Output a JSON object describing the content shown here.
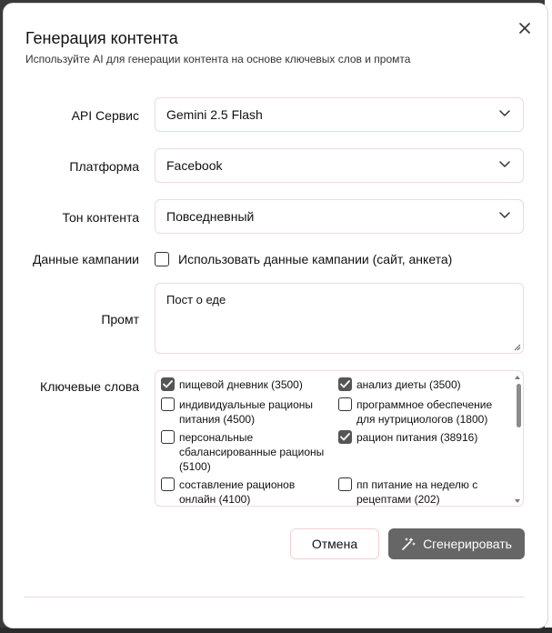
{
  "dialog": {
    "title": "Генерация контента",
    "subtitle": "Используйте AI для генерации контента на основе ключевых слов и промта"
  },
  "fields": {
    "api_label": "API Сервис",
    "api_value": "Gemini 2.5 Flash",
    "platform_label": "Платформа",
    "platform_value": "Facebook",
    "tone_label": "Тон контента",
    "tone_value": "Повседневный",
    "campaign_label": "Данные кампании",
    "campaign_checkbox_label": "Использовать данные кампании (сайт, анкета)",
    "campaign_checked": false,
    "prompt_label": "Промт",
    "prompt_value": "Пост о еде",
    "keywords_label": "Ключевые слова"
  },
  "keywords": [
    {
      "label": "пищевой дневник (3500)",
      "checked": true
    },
    {
      "label": "анализ диеты (3500)",
      "checked": true
    },
    {
      "label": "индивидуальные рационы питания (4500)",
      "checked": false
    },
    {
      "label": "программное обеспечение для нутрициологов (1800)",
      "checked": false
    },
    {
      "label": "персональные сбалансированные рационы (5100)",
      "checked": false
    },
    {
      "label": "рацион питания (38916)",
      "checked": true
    },
    {
      "label": "составление рационов онлайн (4100)",
      "checked": false
    },
    {
      "label": "пп питание на неделю с рецептами (202)",
      "checked": false
    }
  ],
  "buttons": {
    "cancel": "Отмена",
    "generate": "Сгенерировать"
  },
  "icons": {
    "close": "close-icon",
    "chevron": "chevron-down-icon",
    "generate": "magic-wand-icon",
    "check": "check-icon"
  },
  "colors": {
    "button_primary": "#666666",
    "field_border": "#f2d9dc",
    "checkbox_checked": "#555555"
  }
}
